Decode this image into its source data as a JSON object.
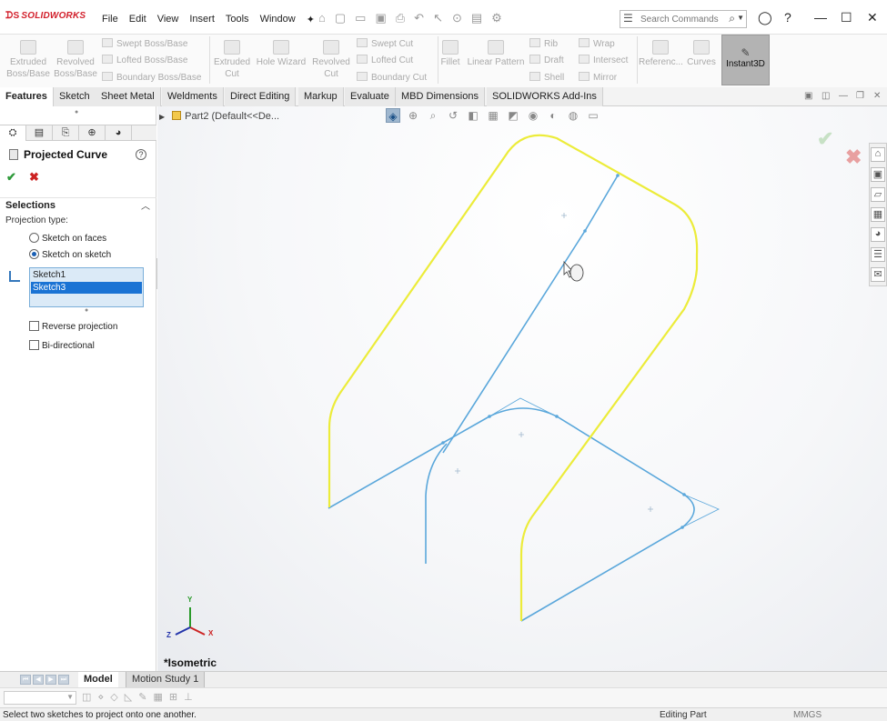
{
  "app": {
    "logo": "SOLIDWORKS",
    "menus": [
      "File",
      "Edit",
      "View",
      "Insert",
      "Tools",
      "Window"
    ],
    "search_placeholder": "Search Commands"
  },
  "ribbon": {
    "extruded_boss": "Extruded Boss/Base",
    "revolved_boss": "Revolved Boss/Base",
    "swept_boss": "Swept Boss/Base",
    "lofted_boss": "Lofted Boss/Base",
    "boundary_boss": "Boundary Boss/Base",
    "extruded_cut": "Extruded Cut",
    "hole_wizard": "Hole Wizard",
    "revolved_cut": "Revolved Cut",
    "swept_cut": "Swept Cut",
    "lofted_cut": "Lofted Cut",
    "boundary_cut": "Boundary Cut",
    "fillet": "Fillet",
    "linear_pattern": "Linear Pattern",
    "rib": "Rib",
    "draft": "Draft",
    "shell": "Shell",
    "wrap": "Wrap",
    "intersect": "Intersect",
    "mirror": "Mirror",
    "reference": "Referenc...",
    "curves": "Curves",
    "instant3d": "Instant3D"
  },
  "tabs": [
    "Features",
    "Sketch",
    "Sheet Metal",
    "Weldments",
    "Direct Editing",
    "Markup",
    "Evaluate",
    "MBD Dimensions",
    "SOLIDWORKS Add-Ins"
  ],
  "property_manager": {
    "title": "Projected Curve",
    "help": "?",
    "section_selections": "Selections",
    "projection_type_label": "Projection type:",
    "option_faces": "Sketch on faces",
    "option_sketch": "Sketch on sketch",
    "selected_option": "Sketch on sketch",
    "selections": [
      "Sketch1",
      "Sketch3"
    ],
    "reverse_projection": "Reverse projection",
    "bidirectional": "Bi-directional"
  },
  "viewport": {
    "tree_item": "Part2  (Default<<De...",
    "view_name": "*Isometric",
    "triad": {
      "x": "X",
      "y": "Y",
      "z": "Z"
    },
    "colors": {
      "projected_curve": "#ecec3a",
      "sketch": "#5aa7db",
      "background": "#f4f5f8"
    }
  },
  "bottom_tabs": [
    "Model",
    "Motion Study 1"
  ],
  "status": {
    "message": "Select two sketches to project onto one another.",
    "mode": "Editing Part",
    "units": "MMGS"
  }
}
